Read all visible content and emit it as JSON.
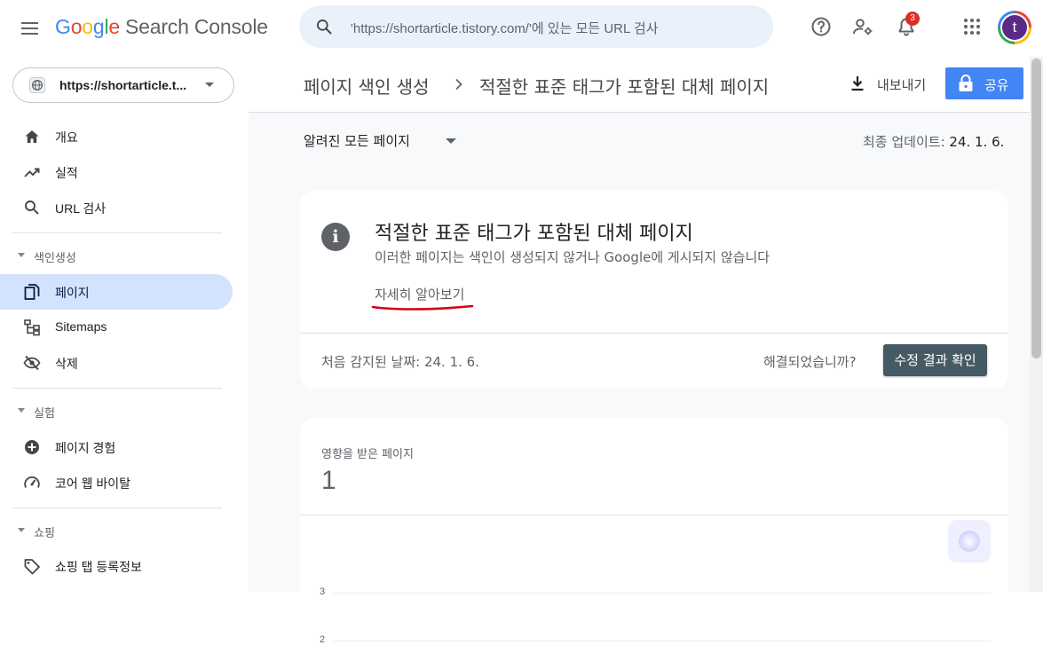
{
  "app": {
    "logo_letters": [
      "G",
      "o",
      "o",
      "g",
      "l",
      "e"
    ],
    "product_name": "Search Console"
  },
  "search": {
    "placeholder": "'https://shortarticle.tistory.com/'에 있는 모든 URL 검사"
  },
  "toolbar": {
    "help_icon": "help-icon",
    "settings_icon": "manage-users-icon",
    "notifications_icon": "bell-icon",
    "notification_count": "3",
    "apps_icon": "apps-grid-icon",
    "avatar_letter": "t"
  },
  "property": {
    "label": "https://shortarticle.t..."
  },
  "sidebar": {
    "items_top": [
      {
        "label": "개요",
        "icon": "home-icon"
      },
      {
        "label": "실적",
        "icon": "trending-up-icon"
      },
      {
        "label": "URL 검사",
        "icon": "search-icon"
      }
    ],
    "sections": [
      {
        "title": "색인생성",
        "items": [
          {
            "label": "페이지",
            "icon": "pages-icon",
            "active": true
          },
          {
            "label": "Sitemaps",
            "icon": "sitemap-icon"
          },
          {
            "label": "삭제",
            "icon": "visibility-off-icon"
          }
        ]
      },
      {
        "title": "실험",
        "items": [
          {
            "label": "페이지 경험",
            "icon": "plus-circle-icon"
          },
          {
            "label": "코어 웹 바이탈",
            "icon": "speed-gauge-icon"
          }
        ]
      },
      {
        "title": "쇼핑",
        "items": [
          {
            "label": "쇼핑 탭 등록정보",
            "icon": "tag-icon"
          }
        ]
      }
    ]
  },
  "header": {
    "breadcrumb_parent": "페이지 색인 생성",
    "breadcrumb_current": "적절한 표준 태그가 포함된 대체 페이지",
    "export_label": "내보내기",
    "share_label": "공유"
  },
  "filter": {
    "selected": "알려진 모든 페이지",
    "updated_prefix": "최종 업데이트:",
    "updated_date": "24. 1. 6."
  },
  "issue_card": {
    "title": "적절한 표준 태그가 포함된 대체 페이지",
    "description": "이러한 페이지는 색인이 생성되지 않거나 Google에 게시되지 않습니다",
    "learn_more": "자세히 알아보기",
    "first_detected": "처음 감지된 날짜: 24. 1. 6.",
    "resolved_question": "해결되었습니까?",
    "validate_label": "수정 결과 확인"
  },
  "affected_card": {
    "label": "영향을 받은 페이지",
    "value": "1"
  },
  "colors": {
    "brand_blue": "#4285f4",
    "active_nav": "#d3e3fd",
    "validate_button": "#455a64",
    "annotation_red": "#d0021b"
  },
  "chart_data": {
    "type": "bar",
    "y_ticks": [
      "3",
      "2"
    ],
    "ylim": [
      0,
      3
    ],
    "grid": true
  }
}
